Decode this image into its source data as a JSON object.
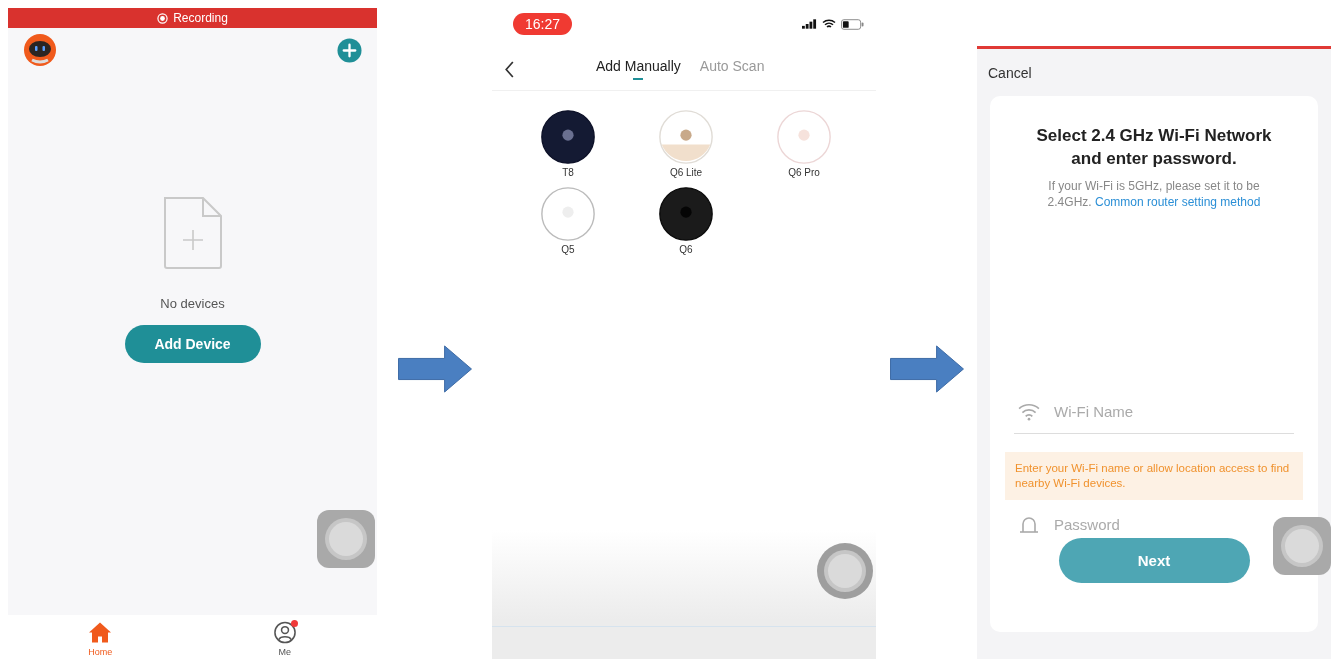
{
  "home_screen": {
    "recording_banner": "Recording",
    "empty_state": "No devices",
    "add_button": "Add Device",
    "tab_bar": [
      {
        "label": "Home",
        "kind": "home",
        "selected": true,
        "badge": false
      },
      {
        "label": "Me",
        "kind": "profile",
        "selected": false,
        "badge": true
      }
    ]
  },
  "add_device_screen": {
    "time": "16:27",
    "tabs": [
      {
        "label": "Add Manually",
        "selected": true
      },
      {
        "label": "Auto Scan",
        "selected": false
      }
    ],
    "models": [
      {
        "name": "T8",
        "kind": "navy"
      },
      {
        "name": "Q6 Lite",
        "kind": "beige"
      },
      {
        "name": "Q6 Pro",
        "kind": "pink"
      },
      {
        "name": "Q5",
        "kind": "outline"
      },
      {
        "name": "Q6",
        "kind": "black"
      }
    ]
  },
  "wifi_screen": {
    "cancel": "Cancel",
    "title": "Select 2.4 GHz Wi-Fi Network and enter password.",
    "note": "If your Wi-Fi is 5GHz, please set it to be 2.4GHz.",
    "link": "Common router setting method",
    "wifi_field": {
      "placeholder": "Wi-Fi Name"
    },
    "warning": "Enter your Wi-Fi name or allow location access to find nearby Wi-Fi devices.",
    "password_field": {
      "placeholder": "Password"
    },
    "next_button": {
      "label": "Next",
      "disabled": true
    }
  }
}
